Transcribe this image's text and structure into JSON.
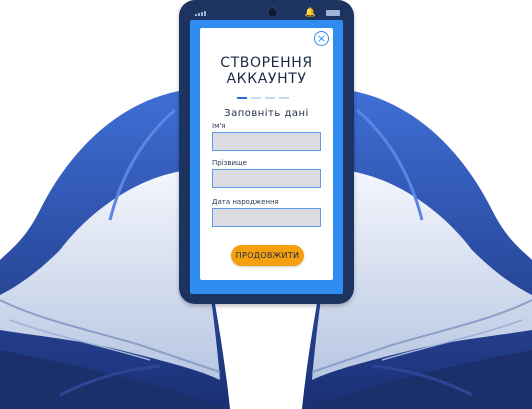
{
  "form": {
    "title_line1": "СТВОРЕННЯ",
    "title_line2": "АККАУНТУ",
    "subtitle": "Заповніть дані",
    "fields": [
      {
        "label": "Ім'я",
        "value": ""
      },
      {
        "label": "Прізвище",
        "value": ""
      },
      {
        "label": "Дата народження",
        "value": ""
      }
    ],
    "submit_label": "ПРОДОВЖИТИ",
    "close_glyph": "×",
    "progress": {
      "current_step": 1,
      "total_steps": 4
    }
  },
  "phone": {
    "bell_glyph": "🔔"
  },
  "colors": {
    "screen": "#2f8cf0",
    "phone_body": "#1e3460",
    "accent_button": "#f5a00e",
    "wing_dark_blue": "#1b3a8a",
    "wing_light": "#d9e2f5"
  },
  "icons": [
    "close-icon",
    "bell-icon",
    "signal-icon",
    "battery-icon",
    "camera-icon",
    "wings-illustration"
  ]
}
